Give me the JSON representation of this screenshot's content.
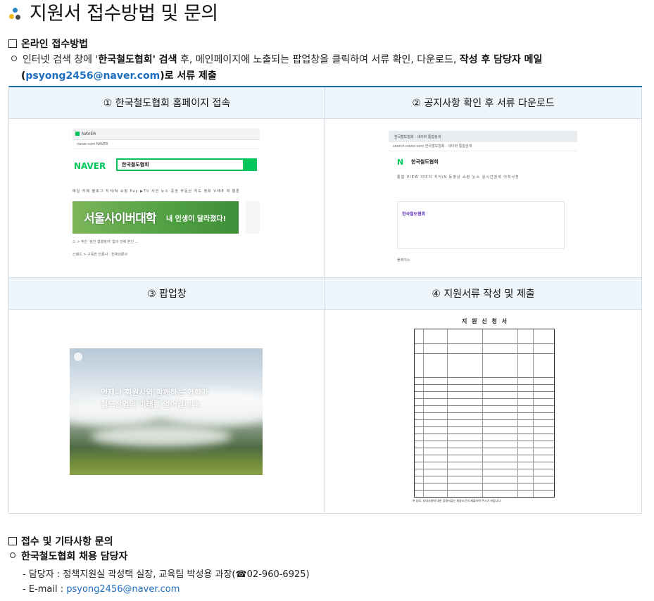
{
  "title": "지원서 접수방법 및 문의",
  "online": {
    "heading": "온라인 접수방법",
    "line1_pre": "인터넷 검색 창에 '",
    "line1_bold": "한국철도협회' 검색",
    "line1_mid": " 후, 메인페이지에 노출되는 팝업창을 클릭하여 서류 확인, 다운로드, ",
    "line1_bold2": "작성 후 담당자 메일",
    "line2_open": "(",
    "email": "psyong2456@naver.com",
    "line2_close": ")로 서류 제출"
  },
  "steps": [
    {
      "label": "① 한국철도협회 홈페이지 접속"
    },
    {
      "label": "② 공지사항 확인 후 서류 다운로드"
    },
    {
      "label": "③ 팝업창"
    },
    {
      "label": "④ 지원서류 작성 및 제출"
    }
  ],
  "thumb1": {
    "tab": "NAVER",
    "url": "naver.com  NAVER",
    "logo": "NAVER",
    "query": "한국철도협회",
    "menu": "메일 카페 블로그 지식iN 쇼핑 Pay ▶TV 사전 뉴스 증권 부동산 지도 영화 VIBE 책 웹툰",
    "banner": "서울사이버대학",
    "banner2": "내 인생이 달라졌다!",
    "line1": "스 > 주간 '검진 집행정지' 합의 언제 본인 ...",
    "line2": "스탠드 > 구독한 언론사 · 전체언론사"
  },
  "thumb2": {
    "tab": "한국철도협회 : 네이버 통합검색",
    "url": "search.naver.com  한국철도협회 : 네이버 통합검색",
    "logo": "N",
    "query": "한국철도협회",
    "menu": "통합 VIEW 이미지 지식iN 동영상 쇼핑 뉴스 실시간검색 어학사전",
    "result": "한국철도협회",
    "footer": "플레이스"
  },
  "thumb3": {
    "line1": "언제나 회원사와 함께하는 협회가",
    "line2": "철도산업의 미래를 열어갑니다."
  },
  "thumb4": {
    "title": "지 원 신 청 서",
    "note": "※ 상로, 부대사항에 대한 증명서류는 채용조건의 제출하여 주시기 바랍니다."
  },
  "contact": {
    "heading": "접수 및 기타사항 문의",
    "sub": "한국철도협회 채용 담당자",
    "person": "- 담당자 : 정책지원실 곽성택 실장, 교육팀 박성용 과장(☎02-960-6925)",
    "email_label": "- E-mail : ",
    "email": "psyong2456@naver.com"
  },
  "colors": {
    "accent": "#1e6ea8",
    "header_bg": "#eef6fb",
    "link": "#1f6fc1",
    "naver_green": "#03c75a"
  }
}
